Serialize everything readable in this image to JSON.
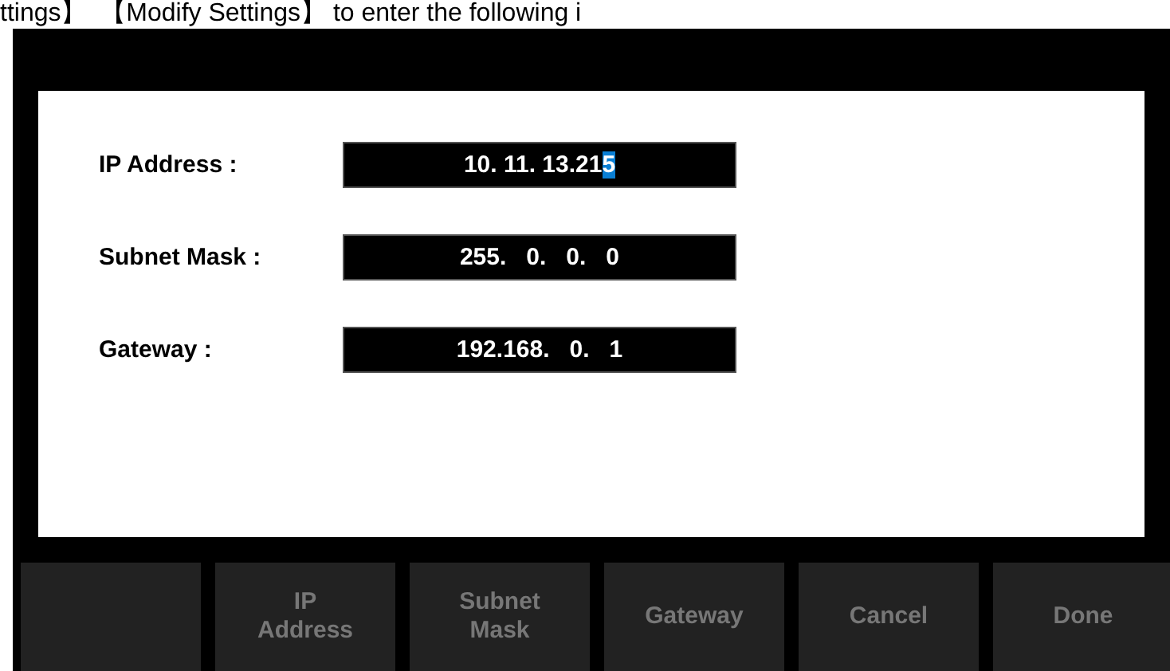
{
  "caption": "ttings】  【Modify Settings】 to enter the following i",
  "fields": [
    {
      "label": "IP Address :",
      "value": "10. 11. 13.21",
      "cursor_char": "5"
    },
    {
      "label": "Subnet Mask :",
      "value": "255.   0.   0.   0"
    },
    {
      "label": "Gateway :",
      "value": "192.168.   0.   1"
    }
  ],
  "softkeys": [
    {
      "lines": [
        "IP",
        "Address"
      ]
    },
    {
      "lines": [
        "Subnet",
        "Mask"
      ]
    },
    {
      "lines": [
        "Gateway"
      ]
    },
    {
      "lines": [
        "Cancel"
      ]
    },
    {
      "lines": [
        "Done"
      ]
    }
  ]
}
